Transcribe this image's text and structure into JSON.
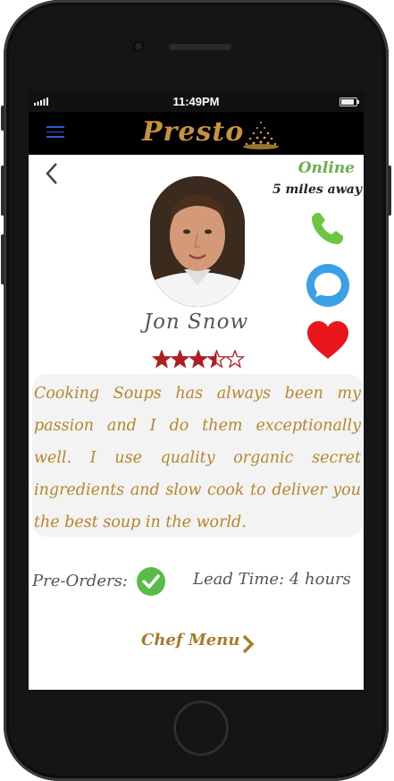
{
  "status_bar": {
    "time": "11:49PM"
  },
  "app": {
    "brand": "Presto"
  },
  "chef": {
    "name": "Jon Snow",
    "status": "Online",
    "distance": "5 miles away",
    "rating": 3.5,
    "rating_max": 5,
    "bio": "Cooking Soups has always been my passion and I do them exceptionally well. I use quality organic secret ingredients and slow cook  to deliver you the best soup in the world."
  },
  "details": {
    "preorders_label": "Pre-Orders:",
    "lead_time": "Lead Time: 4 hours"
  },
  "menu_link": {
    "label": "Chef Menu"
  },
  "colors": {
    "online": "#6ab04c",
    "brand": "#c8923b",
    "bio_text": "#b5862e",
    "call": "#6cc644",
    "message": "#3aa0e8",
    "favorite": "#e8161b",
    "star": "#b01e22"
  },
  "icons": [
    "menu-icon",
    "back-icon",
    "phone-icon",
    "chat-icon",
    "heart-icon",
    "star-icon",
    "check-icon",
    "chevron-right-icon"
  ]
}
